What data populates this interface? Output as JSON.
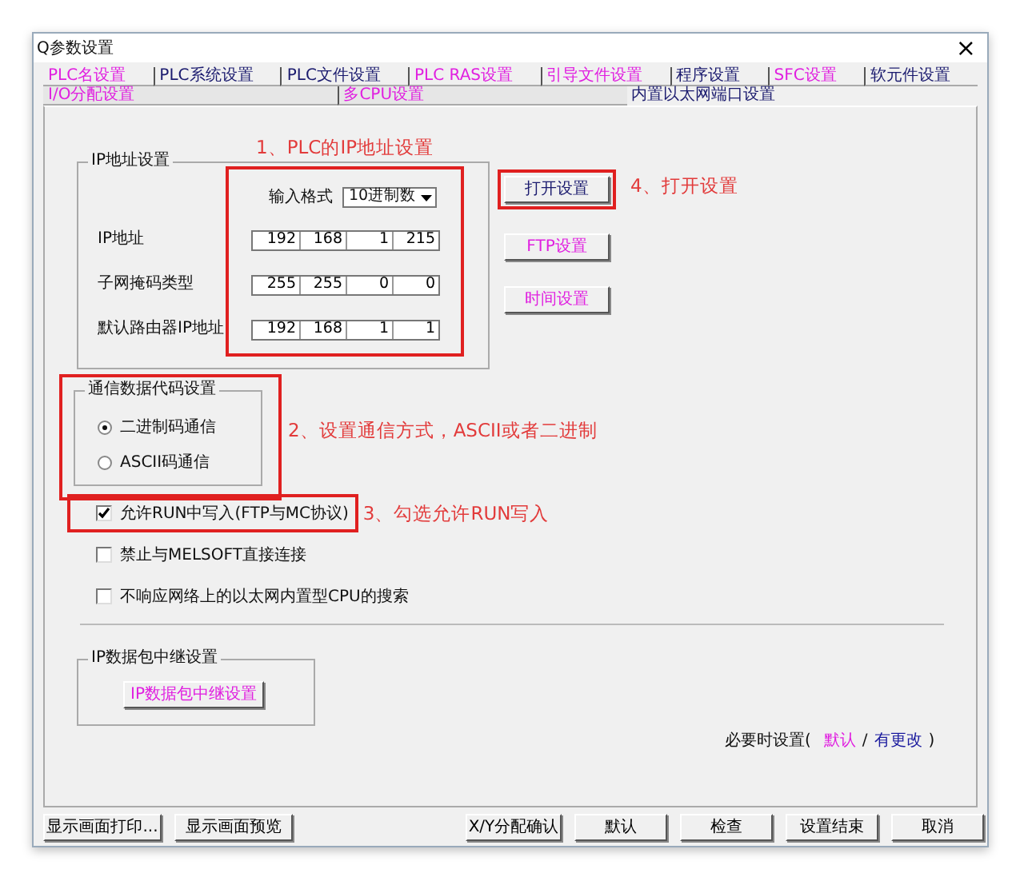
{
  "window": {
    "title": "Q参数设置",
    "close": "×"
  },
  "tab_rows": [
    [
      {
        "label": "PLC名设置",
        "selected": false,
        "color": "#e020e0"
      },
      {
        "label": "PLC系统设置",
        "selected": false,
        "color": "#1a1a6e"
      },
      {
        "label": "PLC文件设置",
        "selected": false,
        "color": "#1a1a6e"
      },
      {
        "label": "PLC RAS设置",
        "selected": false,
        "color": "#e020e0"
      },
      {
        "label": "引导文件设置",
        "selected": false,
        "color": "#e020e0"
      },
      {
        "label": "程序设置",
        "selected": false,
        "color": "#1a1a6e"
      },
      {
        "label": "SFC设置",
        "selected": false,
        "color": "#e020e0"
      },
      {
        "label": "软元件设置",
        "selected": false,
        "color": "#1a1a6e"
      }
    ],
    [
      {
        "label": "I/O分配设置",
        "selected": false,
        "color": "#e020e0"
      },
      {
        "label": "多CPU设置",
        "selected": false,
        "color": "#e020e0"
      },
      {
        "label": "内置以太网端口设置",
        "selected": true,
        "color": "#1a1a6e"
      }
    ]
  ],
  "ip_settings": {
    "title": "IP地址设置",
    "highlighted": true,
    "note": "1、PLC的IP地址设置",
    "input_format": {
      "label": "输入格式",
      "value": "10进制数"
    },
    "rows": [
      {
        "label": "IP地址",
        "octets": [
          "192",
          "168",
          "1",
          "215"
        ]
      },
      {
        "label": "子网掩码类型",
        "octets": [
          "255",
          "255",
          "0",
          "0"
        ]
      },
      {
        "label": "默认路由器IP地址",
        "octets": [
          "192",
          "168",
          "1",
          "1"
        ]
      }
    ]
  },
  "side_buttons": [
    {
      "label": "打开设置",
      "color": "#1a1a6e",
      "highlighted": true,
      "note": "4、打开设置"
    },
    {
      "label": "FTP设置",
      "color": "#e020e0",
      "highlighted": false
    },
    {
      "label": "时间设置",
      "color": "#e020e0",
      "highlighted": false
    }
  ],
  "comm_code": {
    "title": "通信数据代码设置",
    "highlighted": true,
    "note": "2、设置通信方式，ASCII或者二进制",
    "options": [
      {
        "label": "二进制码通信",
        "selected": true
      },
      {
        "label": "ASCII码通信",
        "selected": false
      }
    ]
  },
  "checkboxes": [
    {
      "label": "允许RUN中写入(FTP与MC协议)",
      "checked": true,
      "highlighted": true,
      "note": "3、勾选允许RUN写入"
    },
    {
      "label": "禁止与MELSOFT直接连接",
      "checked": false,
      "highlighted": false
    },
    {
      "label": "不响应网络上的以太网内置型CPU的搜索",
      "checked": false,
      "highlighted": false
    }
  ],
  "relay": {
    "title": "IP数据包中继设置",
    "button": "IP数据包中继设置"
  },
  "footer_note": {
    "prefix": "必要时设置(",
    "default": "默认",
    "separator": "/",
    "changed": "有更改",
    "suffix": ")"
  },
  "bottom_buttons_left": [
    "显示画面打印...",
    "显示画面预览"
  ],
  "bottom_buttons_right": [
    "X/Y分配确认",
    "默认",
    "检查",
    "设置结束",
    "取消"
  ]
}
